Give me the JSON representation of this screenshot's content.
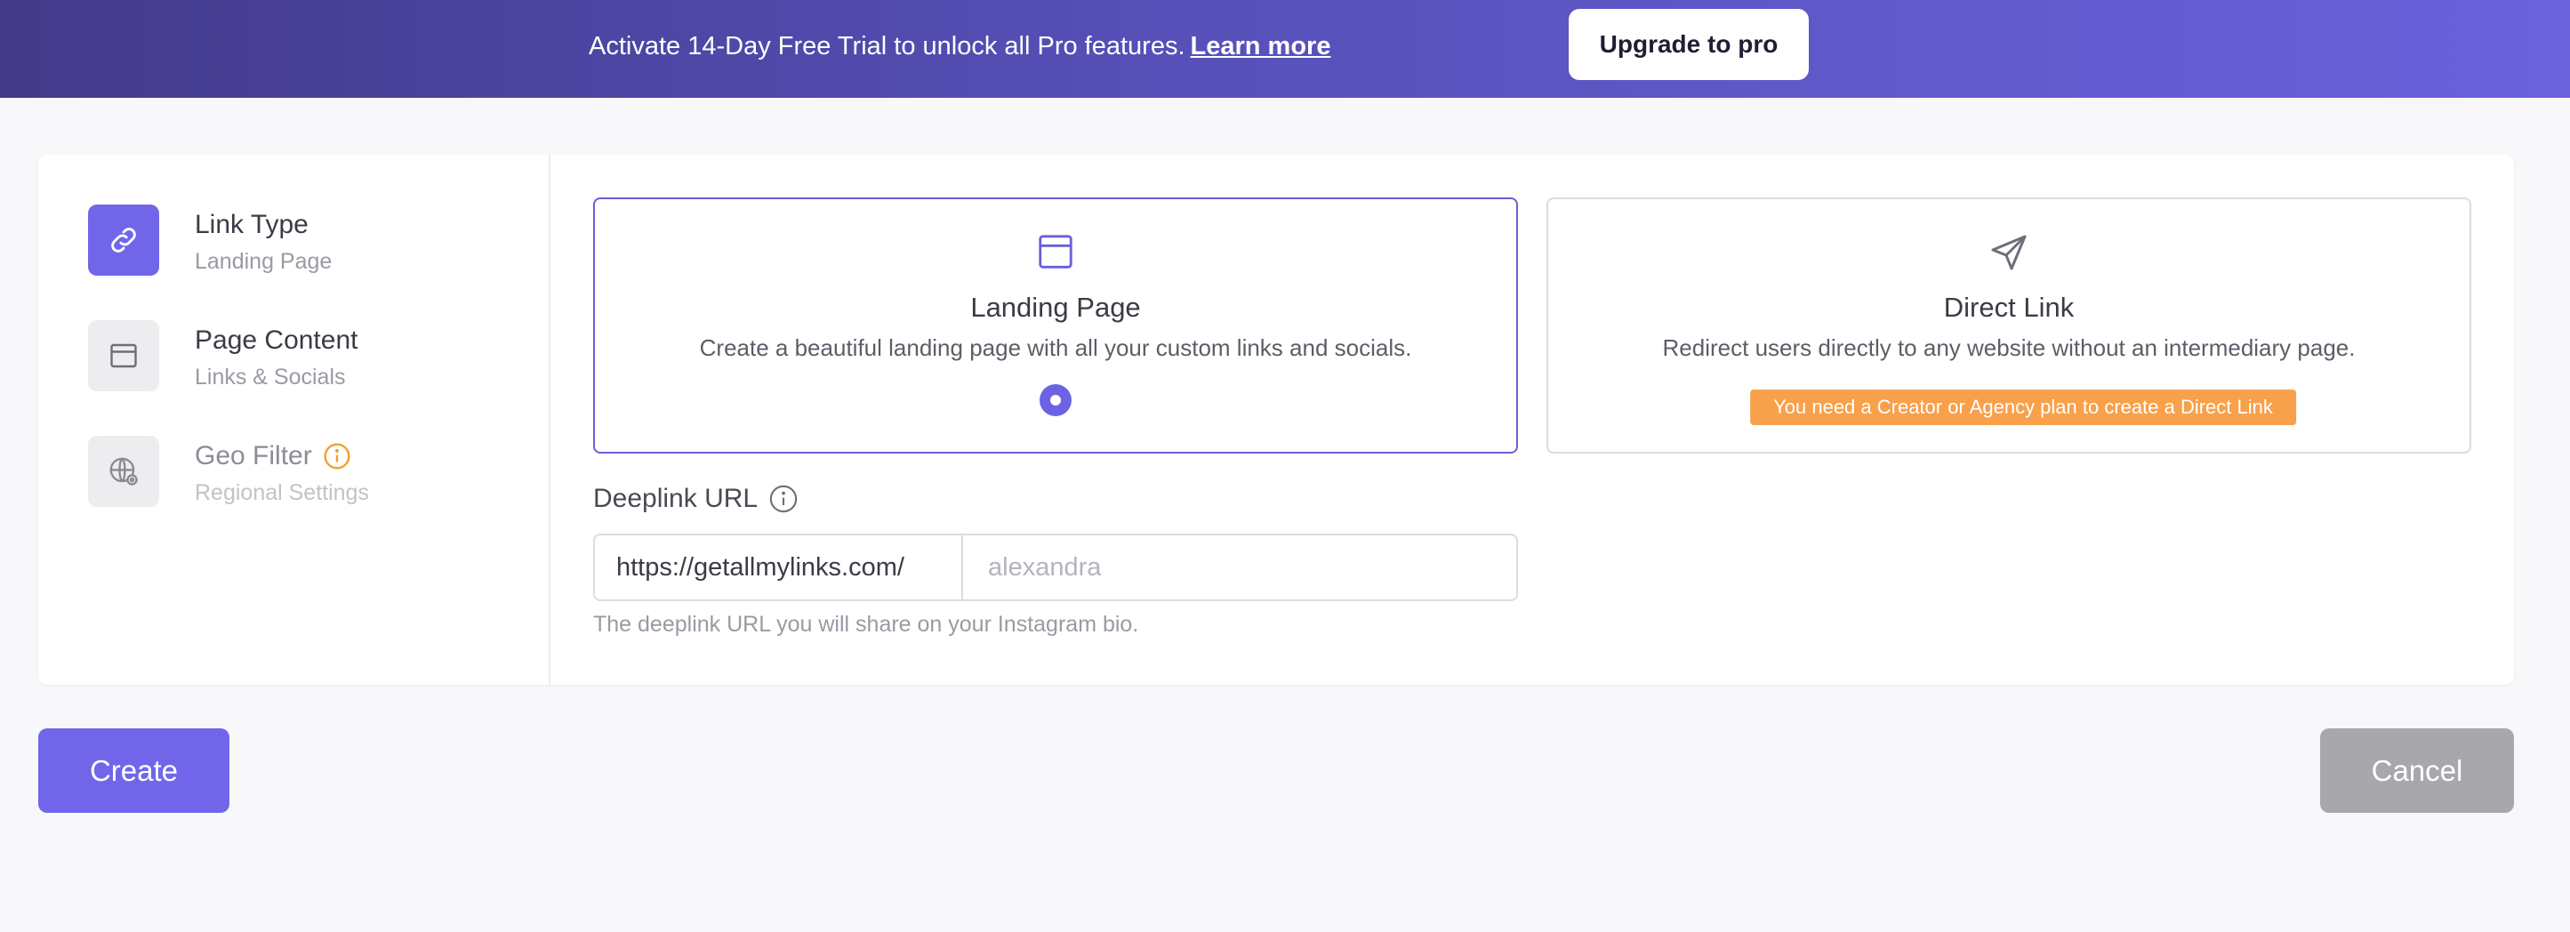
{
  "banner": {
    "text": "Activate 14-Day Free Trial to unlock all Pro features.",
    "link_label": "Learn more",
    "upgrade_label": "Upgrade to pro"
  },
  "steps": [
    {
      "title": "Link Type",
      "subtitle": "Landing Page",
      "icon": "link-icon",
      "active": true
    },
    {
      "title": "Page Content",
      "subtitle": "Links & Socials",
      "icon": "browser-window-icon",
      "active": false
    },
    {
      "title": "Geo Filter",
      "subtitle": "Regional Settings",
      "icon": "globe-settings-icon",
      "active": false,
      "disabled": true
    }
  ],
  "options": {
    "landing": {
      "title": "Landing Page",
      "description": "Create a beautiful landing page with all your custom links and socials.",
      "selected": true,
      "icon": "browser-window-icon"
    },
    "direct": {
      "title": "Direct Link",
      "description": "Redirect users directly to any website without an intermediary page.",
      "badge": "You need a Creator or Agency plan to create a Direct Link",
      "selected": false,
      "icon": "paper-plane-icon"
    }
  },
  "deeplink": {
    "label": "Deeplink URL",
    "prefix": "https://getallmylinks.com/",
    "placeholder": "alexandra",
    "value": "",
    "help": "The deeplink URL you will share on your Instagram bio."
  },
  "actions": {
    "create_label": "Create",
    "cancel_label": "Cancel"
  },
  "colors": {
    "accent": "#7166ea",
    "warning": "#f8a04a",
    "cancel": "#a8a8ac"
  }
}
